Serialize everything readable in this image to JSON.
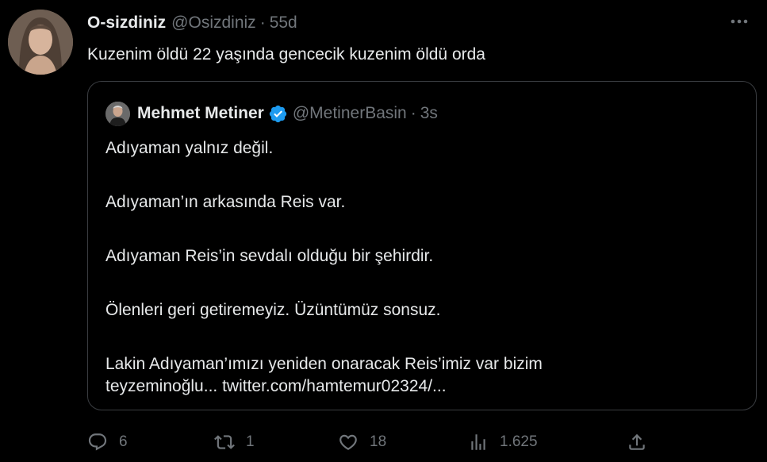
{
  "tweet": {
    "author_name": "O-sizdiniz",
    "author_handle": "@Osizdiniz",
    "separator": "·",
    "time": "55d",
    "text": "Kuzenim öldü 22 yaşında gencecik kuzenim öldü orda",
    "more_icon": "more-horizontal-icon"
  },
  "quote": {
    "author_name": "Mehmet Metiner",
    "author_handle": "@MetinerBasin",
    "separator": "·",
    "time": "3s",
    "verified_icon": "verified-badge-icon",
    "paragraphs": [
      "Adıyaman yalnız değil.",
      "Adıyaman’ın arkasında Reis var.",
      "Adıyaman Reis’in sevdalı olduğu bir şehirdir.",
      "Ölenleri geri getiremeyiz. Üzüntümüz sonsuz.",
      "Lakin Adıyaman’ımızı yeniden onaracak Reis’imiz var bizim",
      "teyzeminoğlu... twitter.com/hamtemur02324/..."
    ]
  },
  "actions": {
    "reply": {
      "icon": "reply-icon",
      "count": "6"
    },
    "retweet": {
      "icon": "retweet-icon",
      "count": "1"
    },
    "like": {
      "icon": "heart-icon",
      "count": "18"
    },
    "views": {
      "icon": "views-chart-icon",
      "count": "1.625"
    },
    "share": {
      "icon": "share-icon",
      "count": ""
    }
  },
  "colors": {
    "background": "#000000",
    "text": "#e7e9ea",
    "muted": "#71767b",
    "border": "#3a3d41",
    "verified": "#1d9bf0"
  }
}
